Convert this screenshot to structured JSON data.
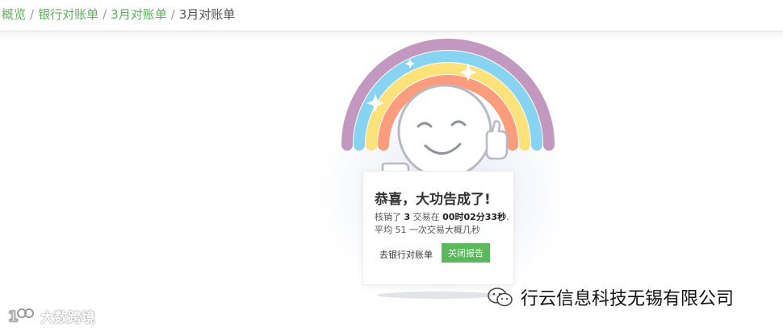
{
  "breadcrumb": {
    "items": [
      "概览",
      "银行对账单",
      "3月对账单"
    ],
    "separator": "/",
    "current": "3月对账单"
  },
  "result": {
    "title": "恭喜，大功告成了!",
    "line1": {
      "prefix": "核销了",
      "count": "3",
      "middle": "交易在",
      "duration": "00时02分33秒",
      "suffix": "."
    },
    "line2": "平均 51 一次交易大概几秒",
    "link_button": "去银行对账单",
    "primary_button": "关闭报告"
  },
  "watermarks": {
    "left": "大数跨境",
    "right": "行云信息科技无锡有限公司"
  },
  "colors": {
    "link": "#5bb35b",
    "primary_button": "#5cb85c",
    "rainbow": [
      "#c398c0",
      "#87d3f2",
      "#fde27b",
      "#fb9c7d"
    ]
  },
  "icons": {
    "illustration": "smiling-face-thumbs-up-rainbow",
    "wechat": "wechat-icon",
    "left_logo": "dashuju-logo-icon"
  }
}
